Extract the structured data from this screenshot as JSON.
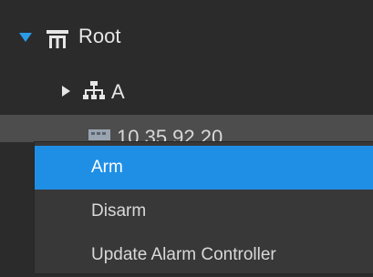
{
  "tree": {
    "root": {
      "label": "Root",
      "icon": "grid-network-icon",
      "expanded": true
    },
    "child_a": {
      "label": "A",
      "icon": "network-topology-icon",
      "expanded": false
    },
    "device": {
      "label": "10.35.92.20",
      "icon": "device-icon"
    }
  },
  "context_menu": {
    "items": [
      {
        "label": "Arm",
        "active": true
      },
      {
        "label": "Disarm",
        "active": false
      },
      {
        "label": "Update Alarm Controller",
        "active": false
      }
    ]
  },
  "colors": {
    "background": "#2b2b2b",
    "selected_row": "#4d4d4d",
    "menu_background": "#383838",
    "menu_highlight": "#1f8fe6",
    "expander_blue": "#2b9be8"
  }
}
